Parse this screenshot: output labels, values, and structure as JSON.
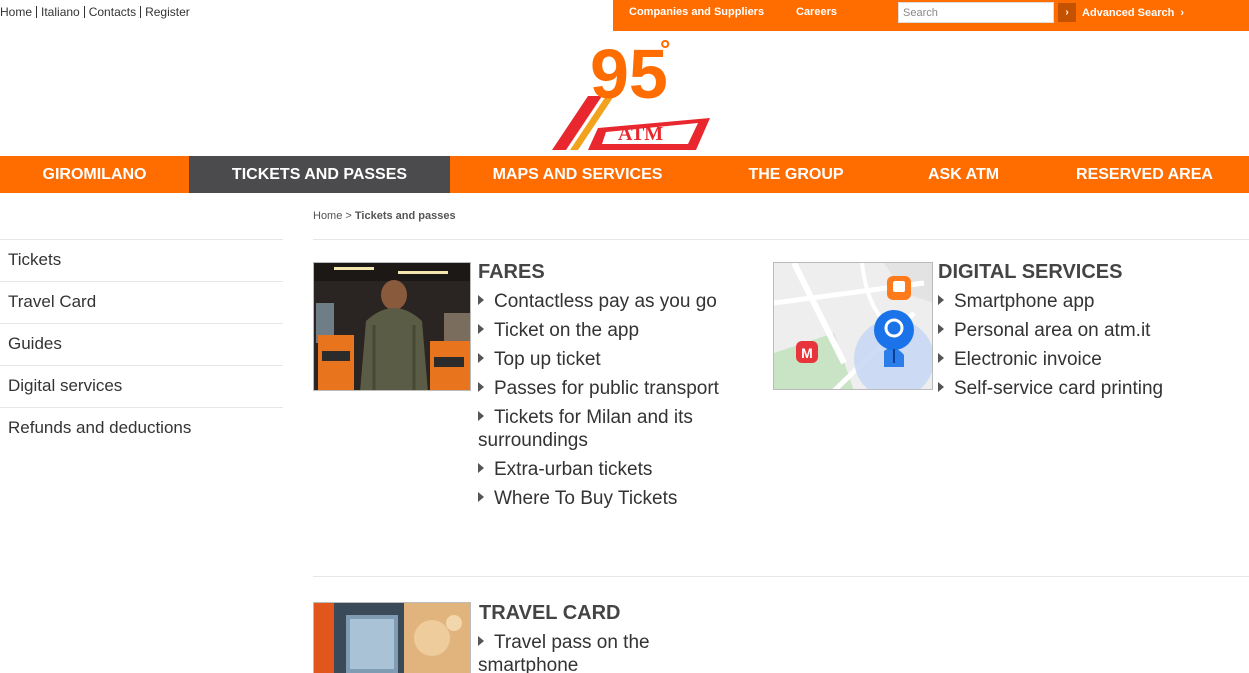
{
  "util_links": [
    "Home",
    "Italiano",
    "Contacts",
    "Register"
  ],
  "topbar": {
    "companies": "Companies and Suppliers",
    "careers": "Careers",
    "search_placeholder": "Search",
    "go_symbol": "›",
    "advanced_search": "Advanced Search",
    "advanced_chevron": "›"
  },
  "logo": {
    "anniversary": "95",
    "degree": "°",
    "brand": "ATM"
  },
  "nav": [
    "GIROMILANO",
    "TICKETS AND PASSES",
    "MAPS AND SERVICES",
    "THE GROUP",
    "ASK ATM",
    "RESERVED AREA"
  ],
  "breadcrumb": {
    "home": "Home",
    "separator": ">",
    "current": "Tickets and passes"
  },
  "sidebar": [
    "Tickets",
    "Travel Card",
    "Guides",
    "Digital services",
    "Refunds and deductions"
  ],
  "sections": {
    "fares": {
      "title": "FARES",
      "links": [
        "Contactless pay as you go",
        "Ticket on the app",
        "Top up ticket",
        "Passes for public transport",
        "Tickets for Milan and its surroundings",
        "Extra-urban tickets",
        "Where To Buy Tickets"
      ]
    },
    "digital": {
      "title": "DIGITAL SERVICES",
      "links": [
        "Smartphone app",
        "Personal area on atm.it",
        "Electronic invoice",
        "Self-service card printing"
      ],
      "map_metro_letter": "M"
    },
    "travel_card": {
      "title": "TRAVEL CARD",
      "links": [
        "Travel pass on the smartphone"
      ]
    }
  },
  "colors": {
    "brand_orange": "#ff6c00",
    "nav_active": "#4b4b4d",
    "metro_red": "#e8353b",
    "pin_blue": "#1a73e8"
  }
}
